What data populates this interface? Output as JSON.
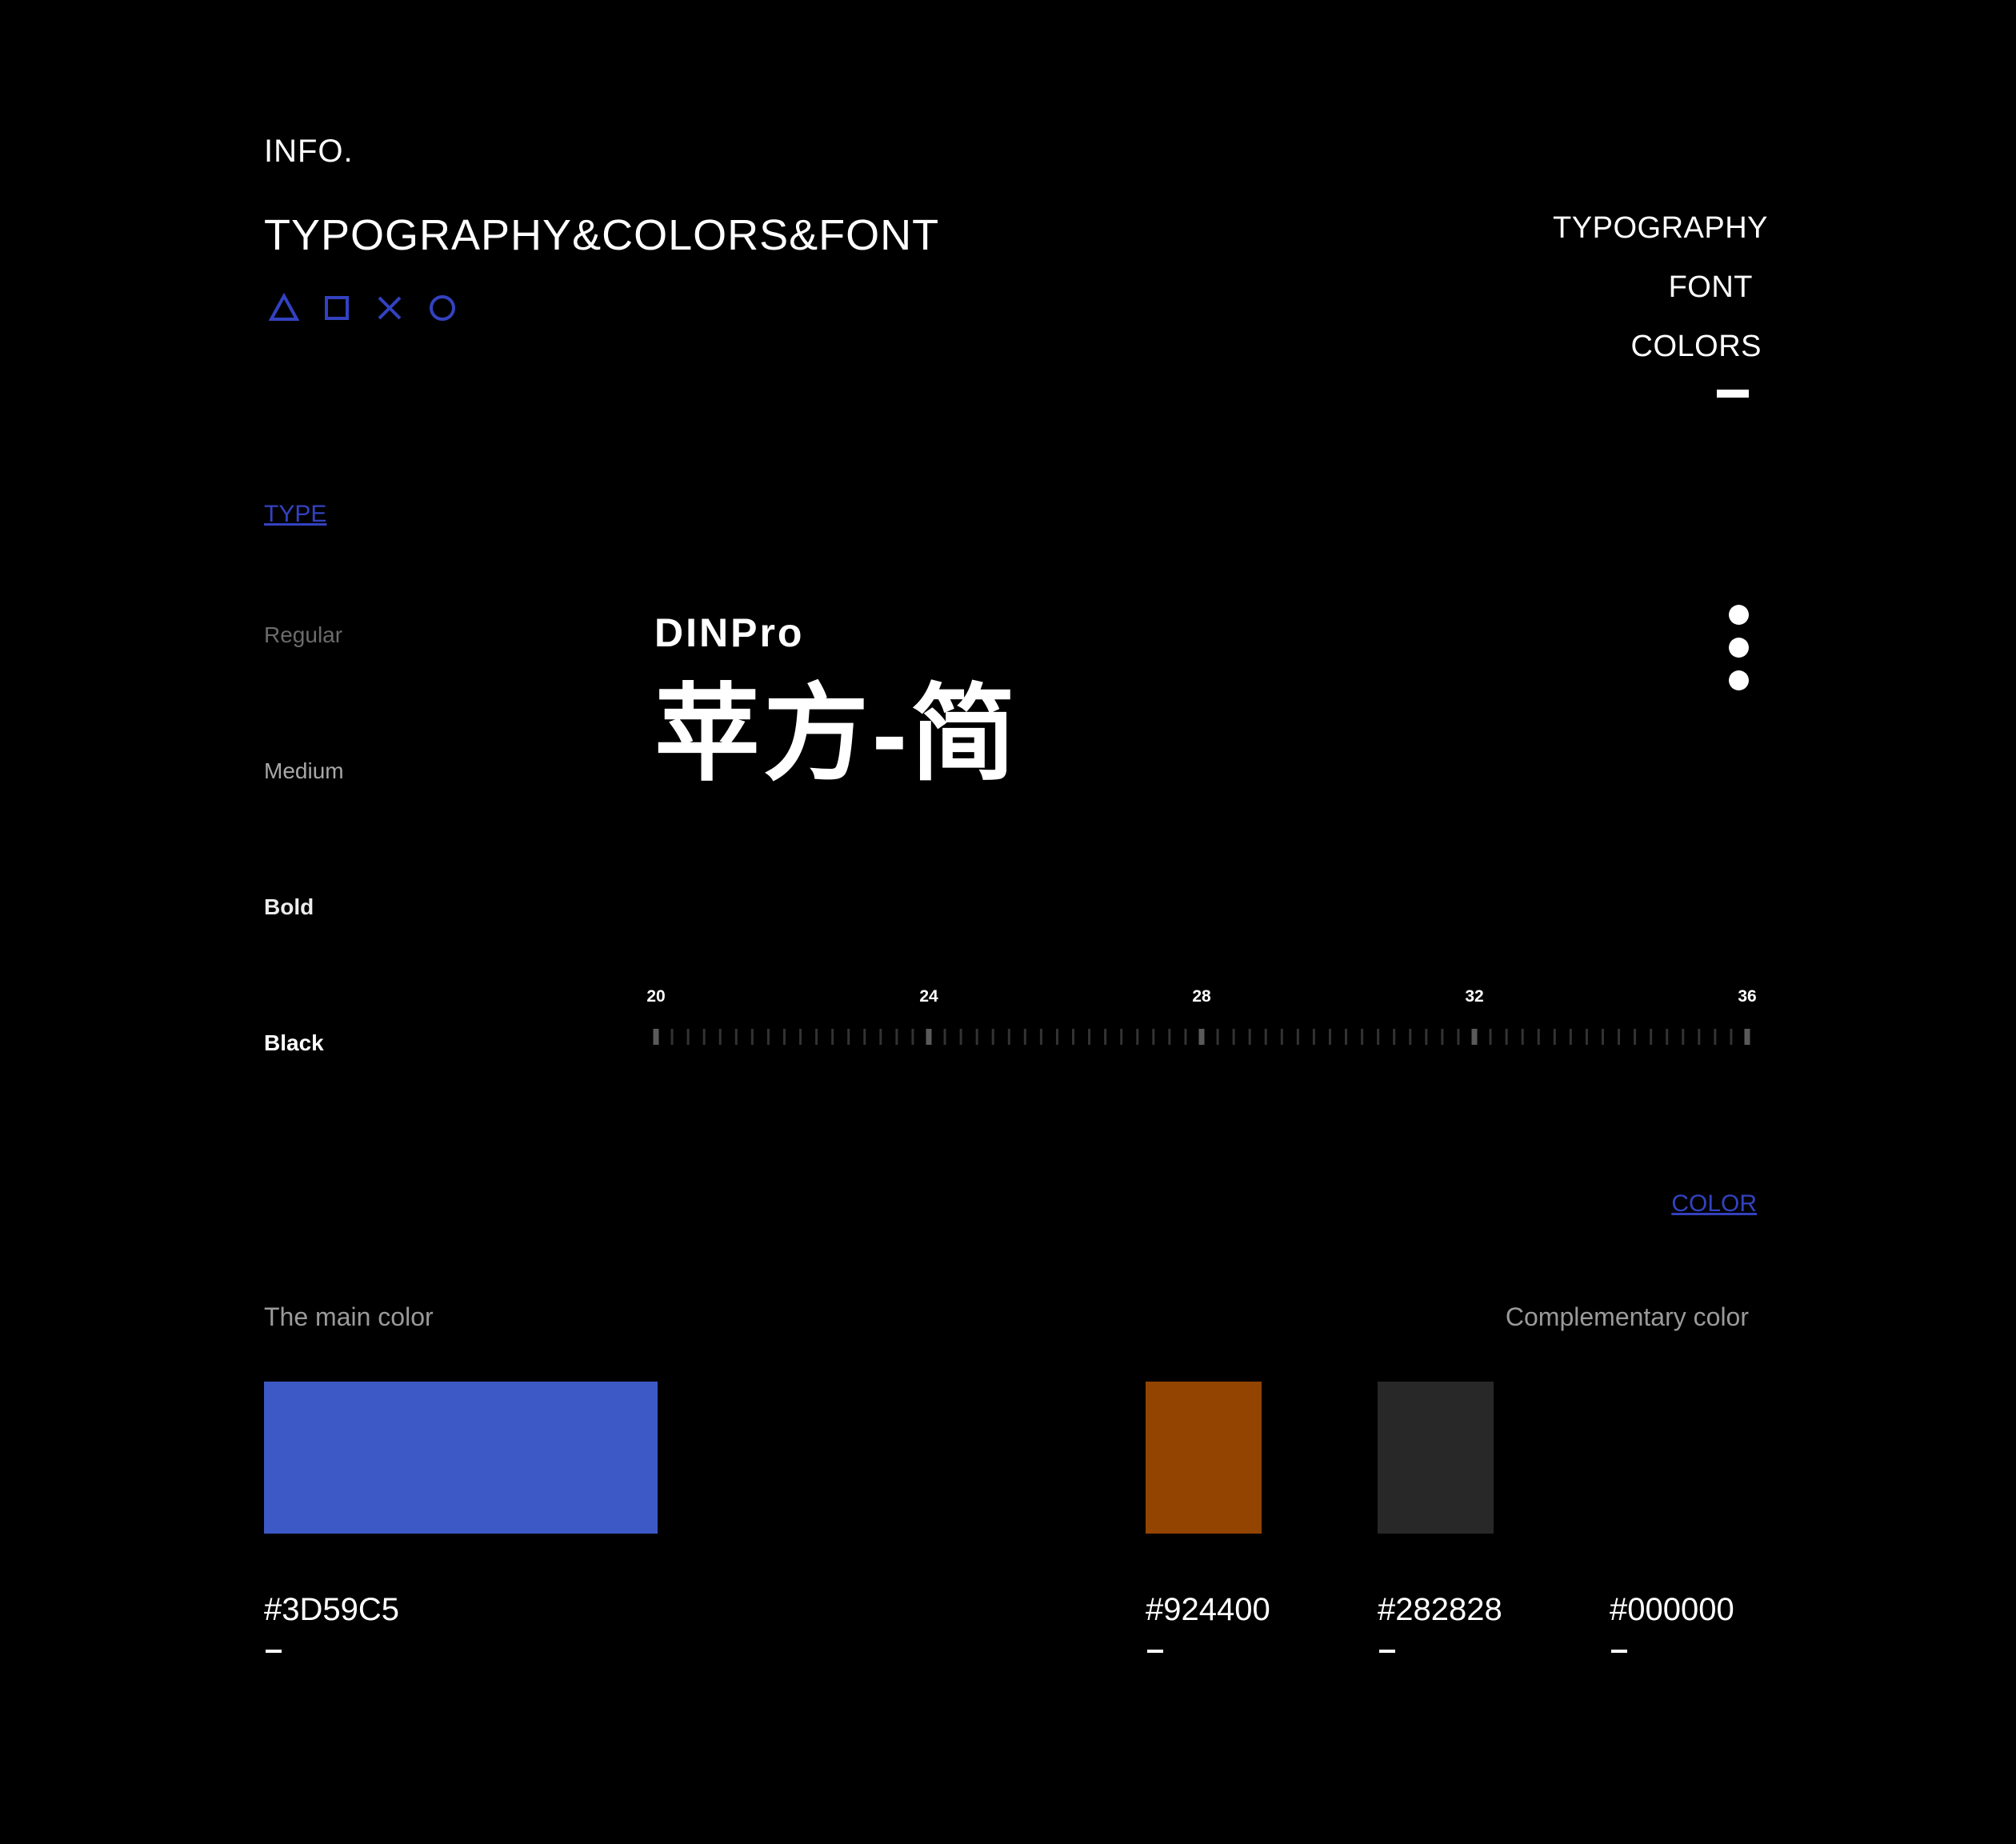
{
  "header": {
    "eyebrow": "INFO.",
    "title": "TYPOGRAPHY&COLORS&FONT",
    "shape_icons": [
      "triangle-icon",
      "square-icon",
      "cross-icon",
      "circle-icon"
    ],
    "accent": "#3342C0"
  },
  "nav": {
    "items": [
      {
        "label": "TYPOGRAPHY"
      },
      {
        "label": "FONT"
      },
      {
        "label": "COLORS"
      }
    ]
  },
  "type_section": {
    "link": "TYPE",
    "weights": [
      "Regular",
      "Medium",
      "Bold",
      "Black"
    ],
    "font_name": "DINPro",
    "font_cn": "苹方-简",
    "menu_icon": "more-vertical-icon",
    "ruler": {
      "labels": [
        "20",
        "24",
        "28",
        "32",
        "36"
      ],
      "min": 20,
      "max": 36
    }
  },
  "color_section": {
    "link": "COLOR",
    "main_heading": "The main color",
    "complementary_heading": "Complementary color",
    "main": {
      "hex": "#3D59C5",
      "color": "#3D59C5"
    },
    "complementary": [
      {
        "hex": "#924400",
        "color": "#924400"
      },
      {
        "hex": "#282828",
        "color": "#282828"
      },
      {
        "hex": "#000000",
        "color": "#000000"
      }
    ]
  }
}
